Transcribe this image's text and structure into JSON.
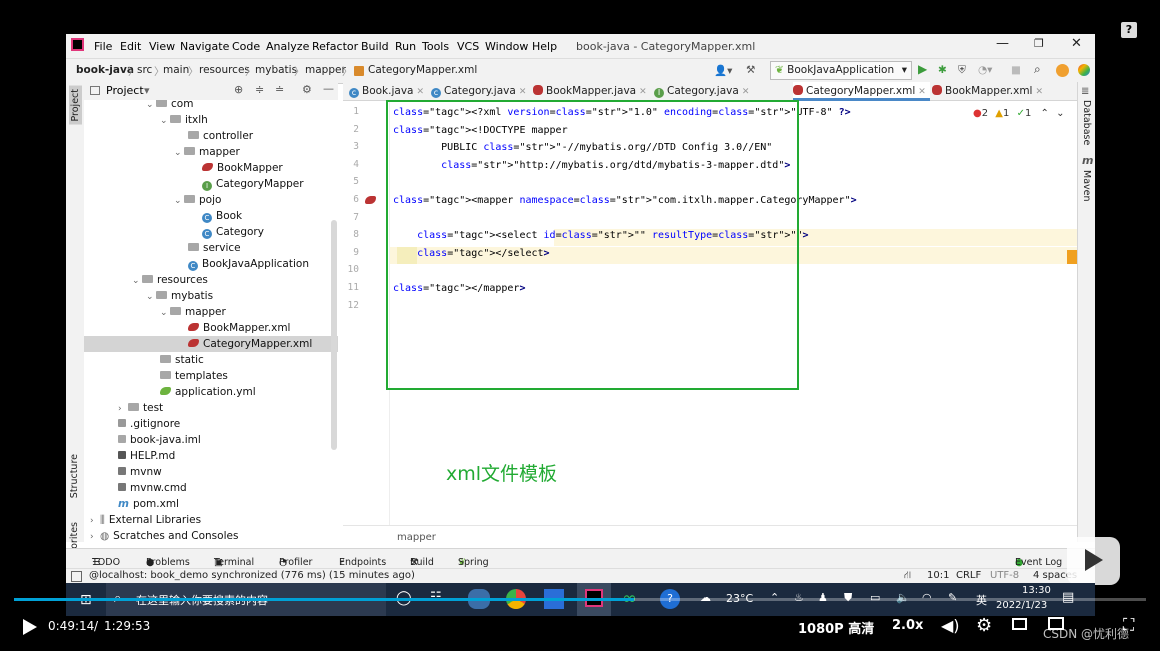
{
  "help_badge": "?",
  "menu": {
    "items": [
      "File",
      "Edit",
      "View",
      "Navigate",
      "Code",
      "Analyze",
      "Refactor",
      "Build",
      "Run",
      "Tools",
      "VCS",
      "Window",
      "Help"
    ],
    "window_title": "book-java - CategoryMapper.xml"
  },
  "breadcrumb": [
    "book-java",
    "src",
    "main",
    "resources",
    "mybatis",
    "mapper",
    "CategoryMapper.xml"
  ],
  "run_config": "BookJavaApplication",
  "project_panel": {
    "title": "Project"
  },
  "left_strip": {
    "project": "Project",
    "structure": "Structure",
    "favorites": "Favorites"
  },
  "right_strip": {
    "database": "Database",
    "maven": "Maven"
  },
  "tabs": [
    {
      "label": "Book.java"
    },
    {
      "label": "Category.java"
    },
    {
      "label": "BookMapper.java"
    },
    {
      "label": "Category.java"
    },
    {
      "label": "CategoryMapper.xml"
    },
    {
      "label": "BookMapper.xml"
    }
  ],
  "tree": [
    {
      "label": "com"
    },
    {
      "label": "itxlh"
    },
    {
      "label": "controller"
    },
    {
      "label": "mapper"
    },
    {
      "label": "BookMapper"
    },
    {
      "label": "CategoryMapper"
    },
    {
      "label": "pojo"
    },
    {
      "label": "Book"
    },
    {
      "label": "Category"
    },
    {
      "label": "service"
    },
    {
      "label": "BookJavaApplication"
    },
    {
      "label": "resources"
    },
    {
      "label": "mybatis"
    },
    {
      "label": "mapper"
    },
    {
      "label": "BookMapper.xml"
    },
    {
      "label": "CategoryMapper.xml"
    },
    {
      "label": "static"
    },
    {
      "label": "templates"
    },
    {
      "label": "application.yml"
    },
    {
      "label": "test"
    },
    {
      "label": ".gitignore"
    },
    {
      "label": "book-java.iml"
    },
    {
      "label": "HELP.md"
    },
    {
      "label": "mvnw"
    },
    {
      "label": "mvnw.cmd"
    },
    {
      "label": "pom.xml"
    },
    {
      "label": "External Libraries"
    },
    {
      "label": "Scratches and Consoles"
    }
  ],
  "editor": {
    "line_numbers": [
      "1",
      "2",
      "3",
      "4",
      "5",
      "6",
      "7",
      "8",
      "9",
      "10",
      "11",
      "12"
    ],
    "lines": [
      "<?xml version=\"1.0\" encoding=\"UTF-8\" ?>",
      "<!DOCTYPE mapper",
      "        PUBLIC \"-//mybatis.org//DTD Config 3.0//EN\"",
      "        \"http://mybatis.org/dtd/mybatis-3-mapper.dtd\">",
      "",
      "<mapper namespace=\"com.itxlh.mapper.CategoryMapper\">",
      "",
      "    <select id=\"\" resultType=\"\">",
      "    </select>",
      "",
      "</mapper>",
      ""
    ],
    "inspections": {
      "errors": "2",
      "warnings": "1",
      "weak": "1"
    },
    "annotation": "xml文件模板",
    "breadcrumb_footer": "mapper",
    "highlight_color": "#fdf6dc",
    "annotation_color": "#22aa33"
  },
  "bottom_tabs": [
    "TODO",
    "Problems",
    "Terminal",
    "Profiler",
    "Endpoints",
    "Build",
    "Spring",
    "Event Log"
  ],
  "status": {
    "message": "@localhost: book_demo synchronized (776 ms) (15 minutes ago)",
    "position": "10:1",
    "line_sep": "CRLF",
    "encoding": "UTF-8",
    "indent": "4 spaces"
  },
  "taskbar": {
    "search_placeholder": "在这里输入你要搜索的内容",
    "weather": "23°C",
    "ime": "英",
    "time": "13:30",
    "date": "2022/1/23"
  },
  "player": {
    "current_time": "0:49:14",
    "separator": "/",
    "duration": "1:29:53",
    "quality": "1080P 高清",
    "speed": "2.0x",
    "progress": 0.548,
    "watermark": "CSDN @忧利德"
  }
}
